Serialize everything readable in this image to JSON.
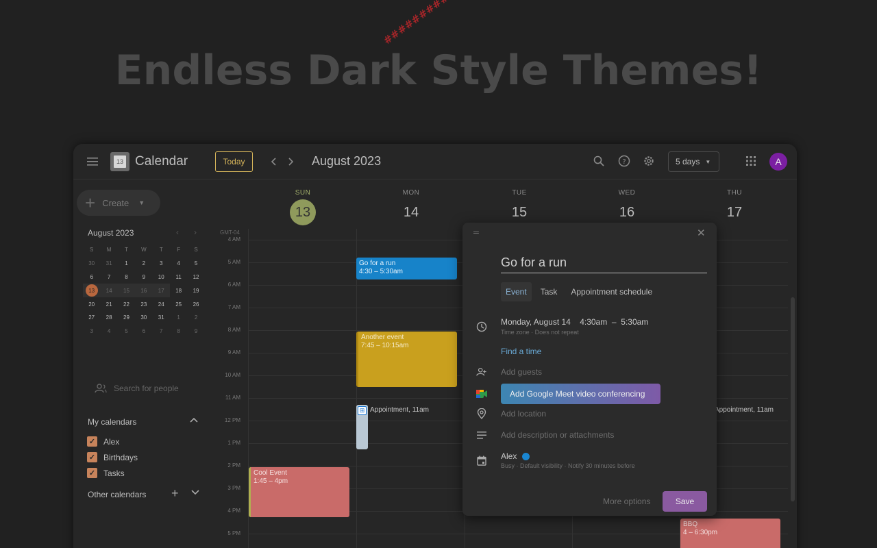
{
  "headline": "Endless Dark Style Themes!",
  "watermark": "##########",
  "topbar": {
    "app_title": "Calendar",
    "logo_day": "13",
    "today_label": "Today",
    "month_title": "August 2023",
    "view_label": "5 days",
    "avatar_initial": "A"
  },
  "sidebar": {
    "create_label": "Create",
    "mini_cal": {
      "title": "August 2023",
      "dows": [
        "S",
        "M",
        "T",
        "W",
        "T",
        "F",
        "S"
      ],
      "weeks": [
        [
          "30",
          "31",
          "1",
          "2",
          "3",
          "4",
          "5"
        ],
        [
          "6",
          "7",
          "8",
          "9",
          "10",
          "11",
          "12"
        ],
        [
          "13",
          "14",
          "15",
          "16",
          "17",
          "18",
          "19"
        ],
        [
          "20",
          "21",
          "22",
          "23",
          "24",
          "25",
          "26"
        ],
        [
          "27",
          "28",
          "29",
          "30",
          "31",
          "1",
          "2"
        ],
        [
          "3",
          "4",
          "5",
          "6",
          "7",
          "8",
          "9"
        ]
      ]
    },
    "search_people_placeholder": "Search for people",
    "my_calendars_title": "My calendars",
    "my_calendars": [
      "Alex",
      "Birthdays",
      "Tasks"
    ],
    "other_calendars_title": "Other calendars"
  },
  "grid": {
    "timezone": "GMT-04",
    "days": [
      {
        "dow": "SUN",
        "num": "13",
        "current": true
      },
      {
        "dow": "MON",
        "num": "14"
      },
      {
        "dow": "TUE",
        "num": "15"
      },
      {
        "dow": "WED",
        "num": "16"
      },
      {
        "dow": "THU",
        "num": "17"
      }
    ],
    "hours": [
      "4 AM",
      "5 AM",
      "6 AM",
      "7 AM",
      "8 AM",
      "9 AM",
      "10 AM",
      "11 AM",
      "12 PM",
      "1 PM",
      "2 PM",
      "3 PM",
      "4 PM",
      "5 PM"
    ]
  },
  "events": {
    "run": {
      "title": "Go for a run",
      "time": "4:30 – 5:30am",
      "color": "#1783c9"
    },
    "another": {
      "title": "Another event",
      "time": "7:45 – 10:15am",
      "color": "#c9a01e"
    },
    "appointment": {
      "title": "Appointment, 11am",
      "color": "#b9c8d4"
    },
    "appointment_thu": {
      "title": "Appointment, 11am"
    },
    "cool": {
      "title": "Cool Event",
      "time": "1:45 – 4pm",
      "color": "#c96b69"
    },
    "bbq": {
      "title": "BBQ",
      "time": "4 – 6:30pm",
      "color": "#c96b69"
    }
  },
  "dialog": {
    "title": "Go for a run",
    "tabs": [
      "Event",
      "Task",
      "Appointment schedule"
    ],
    "date": "Monday, August 14",
    "start": "4:30am",
    "dash": "–",
    "end": "5:30am",
    "sub": "Time zone · Does not repeat",
    "find_time": "Find a time",
    "add_guests": "Add guests",
    "meet_label": "Add Google Meet video conferencing",
    "add_location": "Add location",
    "add_description": "Add description or attachments",
    "owner": "Alex",
    "owner_sub": "Busy · Default visibility · Notify 30 minutes before",
    "more_options": "More options",
    "save": "Save"
  }
}
